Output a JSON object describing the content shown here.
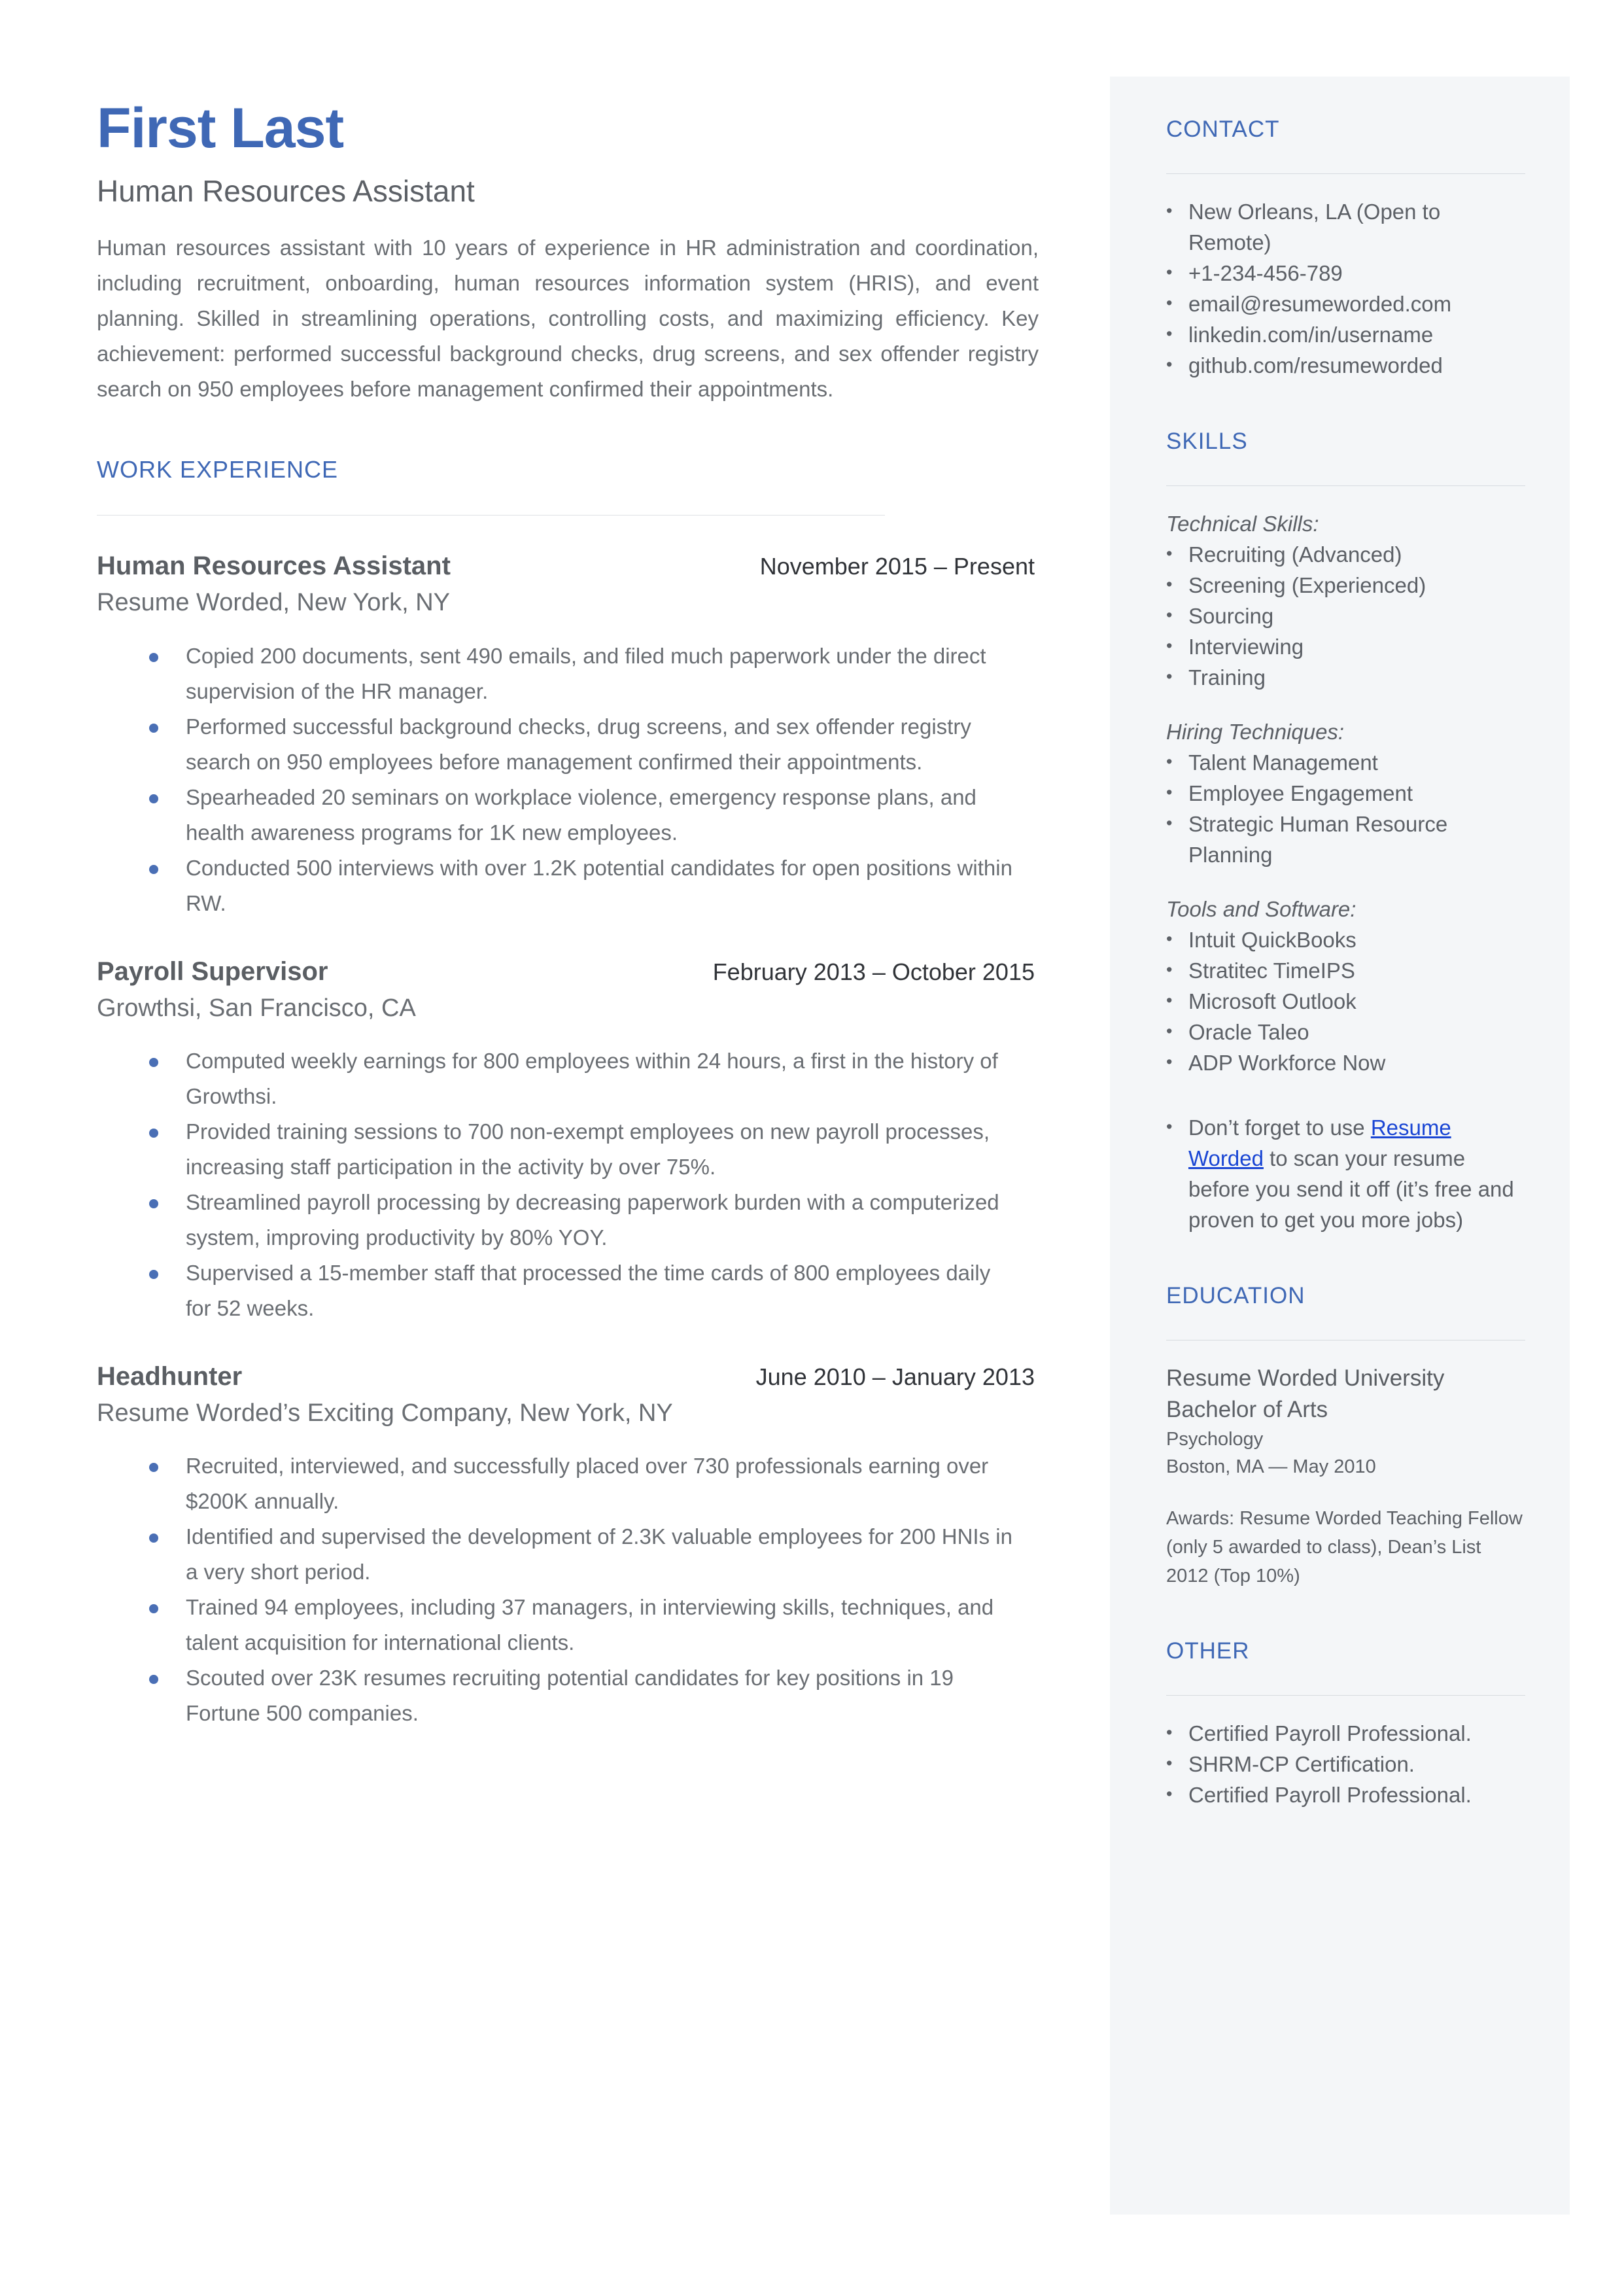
{
  "header": {
    "name": "First Last",
    "headline": "Human Resources Assistant",
    "summary": "Human resources assistant with 10 years of experience in HR administration and coordination, including recruitment, onboarding, human resources information system (HRIS), and event planning. Skilled in streamlining operations, controlling costs, and maximizing efficiency. Key achievement: performed successful background checks, drug screens, and sex offender registry search on 950 employees before management confirmed their appointments."
  },
  "colors": {
    "accent_blue": "#3f68b5",
    "bullet_blue": "#4a6fb5",
    "link_blue": "#1a46d4",
    "body_gray": "#6a6e73",
    "sidebar_bg": "#f4f6f8",
    "rule_gray": "#d7dbe0"
  },
  "work_experience": {
    "heading": "WORK EXPERIENCE",
    "jobs": [
      {
        "title": "Human Resources Assistant",
        "dates": "November 2015 – Present",
        "company": "Resume Worded, New York, NY",
        "bullets": [
          "Copied 200 documents, sent 490 emails, and filed much paperwork under the direct supervision of the HR manager.",
          "Performed successful background checks, drug screens, and sex offender registry search on 950 employees before management confirmed their appointments.",
          "Spearheaded 20 seminars on workplace violence, emergency response plans, and health awareness programs for 1K new employees.",
          "Conducted 500 interviews with over 1.2K potential candidates for open positions within RW."
        ]
      },
      {
        "title": "Payroll Supervisor",
        "dates": "February 2013 – October 2015",
        "company": "Growthsi, San Francisco, CA",
        "bullets": [
          "Computed weekly earnings for 800 employees within 24 hours, a first in the history of Growthsi.",
          "Provided training sessions to 700 non-exempt employees on new payroll processes, increasing staff participation in the activity by over 75%.",
          "Streamlined payroll processing by decreasing paperwork burden with a computerized system, improving productivity by 80% YOY.",
          "Supervised a 15-member staff that processed the time cards of 800 employees daily for 52 weeks."
        ]
      },
      {
        "title": "Headhunter",
        "dates": "June 2010 – January 2013",
        "company": "Resume Worded’s Exciting Company, New York, NY",
        "bullets": [
          "Recruited, interviewed, and successfully placed over 730 professionals earning over $200K annually.",
          "Identified and supervised the development of 2.3K valuable employees for 200 HNIs in a very short period.",
          "Trained 94 employees, including 37 managers, in interviewing skills, techniques, and talent acquisition for international clients.",
          "Scouted over 23K resumes recruiting potential candidates for key positions in 19 Fortune 500 companies."
        ]
      }
    ]
  },
  "sidebar": {
    "contact": {
      "heading": "CONTACT",
      "items": [
        "New Orleans, LA (Open to Remote)",
        "+1-234-456-789",
        "email@resumeworded.com",
        "linkedin.com/in/username",
        "github.com/resumeworded"
      ]
    },
    "skills": {
      "heading": "SKILLS",
      "groups": [
        {
          "label": "Technical Skills:",
          "items": [
            "Recruiting (Advanced)",
            "Screening (Experienced)",
            "Sourcing",
            "Interviewing",
            "Training"
          ]
        },
        {
          "label": "Hiring Techniques:",
          "items": [
            "Talent Management",
            "Employee Engagement",
            "Strategic Human Resource Planning"
          ]
        },
        {
          "label": "Tools and Software:",
          "items": [
            "Intuit QuickBooks",
            "Stratitec TimeIPS",
            "Microsoft Outlook",
            "Oracle Taleo",
            "ADP Workforce Now"
          ]
        }
      ],
      "promo": {
        "before": "Don’t forget to use ",
        "link": "Resume Worded",
        "after": " to scan your resume before you send it off (it’s free and proven to get you more jobs)"
      }
    },
    "education": {
      "heading": "EDUCATION",
      "school": "Resume Worded University",
      "degree": "Bachelor of Arts",
      "field": "Psychology",
      "location_date": "Boston, MA — May 2010",
      "awards": "Awards: Resume Worded Teaching Fellow (only 5 awarded to class), Dean’s List 2012 (Top 10%)"
    },
    "other": {
      "heading": "OTHER",
      "items": [
        "Certified Payroll Professional.",
        "SHRM-CP Certification.",
        "Certified Payroll Professional."
      ]
    }
  }
}
